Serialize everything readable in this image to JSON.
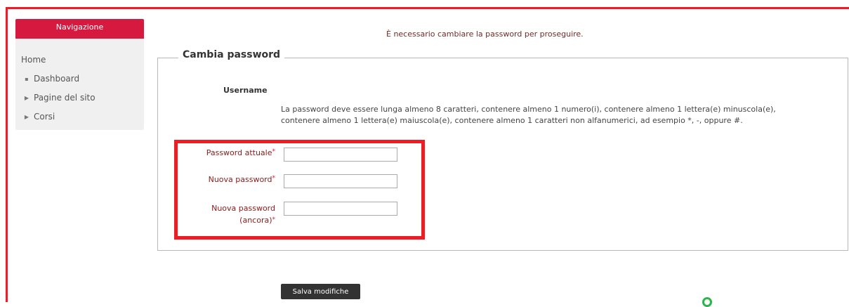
{
  "sidebar": {
    "title": "Navigazione",
    "home": "Home",
    "items": [
      {
        "label": "Dashboard",
        "marker": "▪"
      },
      {
        "label": "Pagine del sito",
        "marker": "▶"
      },
      {
        "label": "Corsi",
        "marker": "▶"
      }
    ]
  },
  "alert": "È necessario cambiare la password per proseguire.",
  "form": {
    "legend": "Cambia password",
    "username_label": "Username",
    "policy": "La password deve essere lunga almeno 8 caratteri, contenere almeno 1 numero(i), contenere almeno 1 lettera(e) minuscola(e), contenere almeno 1 lettera(e) maiuscola(e), contenere almeno 1 caratteri non alfanumerici, ad esempio *, -, oppure #.",
    "required_mark": "*",
    "fields": [
      {
        "label": "Password attuale",
        "value": ""
      },
      {
        "label": "Nuova password",
        "value": ""
      },
      {
        "label_line1": "Nuova password",
        "label_line2": "(ancora)",
        "value": ""
      }
    ],
    "save_label": "Salva modifiche"
  },
  "colors": {
    "accent": "#d6193e",
    "annotation": "#ee1c25",
    "button": "#333333",
    "label": "#8b1a1a"
  }
}
